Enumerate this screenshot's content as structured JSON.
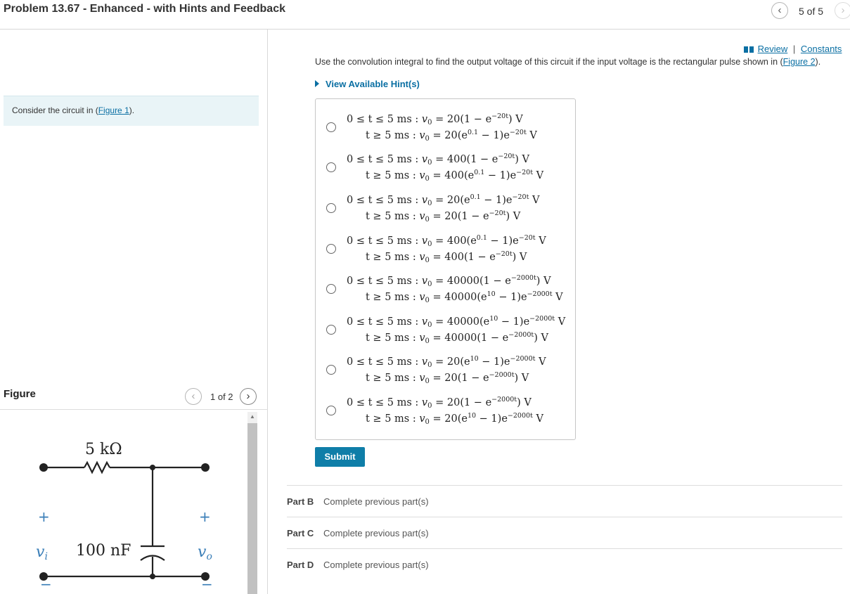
{
  "header": {
    "title": "Problem 13.67 - Enhanced - with Hints and Feedback",
    "prev_icon": "chevron-left-icon",
    "next_icon": "chevron-right-icon",
    "count": "5 of 5"
  },
  "left": {
    "consider_prefix": "Consider the circuit in (",
    "consider_link": "Figure 1",
    "consider_suffix": ").",
    "figure_label": "Figure",
    "figure_count": "1 of 2",
    "circuit": {
      "resistor": "5 kΩ",
      "capacitor": "100 nF",
      "plus": "+",
      "minus": "−",
      "vi": "v",
      "vi_sub": "i",
      "vo": "v",
      "vo_sub": "o"
    }
  },
  "right": {
    "review": "Review",
    "separator": "|",
    "constants": "Constants",
    "instruction_prefix": "Use the convolution integral to find the output voltage of this circuit if the input voltage is the rectangular pulse shown in (",
    "instruction_link": "Figure 2",
    "instruction_suffix": ").",
    "hints": "View Available Hint(s)",
    "submit": "Submit",
    "options": [
      {
        "l1": {
          "cond": "0 ≤ t ≤ 5 ms :",
          "a": "v",
          "s": "0",
          "b": " = 20(1 − e",
          "e1": "−20t",
          "c": ") V",
          "e2": "",
          "d": ""
        },
        "l2": {
          "cond": "t ≥ 5 ms :",
          "a": "v",
          "s": "0",
          "b": " = 20(e",
          "e1": "0.1",
          "c": " − 1)e",
          "e2": "−20t",
          "d": " V"
        }
      },
      {
        "l1": {
          "cond": "0 ≤ t ≤ 5 ms :",
          "a": "v",
          "s": "0",
          "b": " = 400(1 − e",
          "e1": "−20t",
          "c": ") V",
          "e2": "",
          "d": ""
        },
        "l2": {
          "cond": "t ≥ 5 ms :",
          "a": "v",
          "s": "0",
          "b": " = 400(e",
          "e1": "0.1",
          "c": " − 1)e",
          "e2": "−20t",
          "d": " V"
        }
      },
      {
        "l1": {
          "cond": "0 ≤ t ≤ 5 ms :",
          "a": "v",
          "s": "0",
          "b": " = 20(e",
          "e1": "0.1",
          "c": " − 1)e",
          "e2": "−20t",
          "d": " V"
        },
        "l2": {
          "cond": "t ≥ 5 ms :",
          "a": "v",
          "s": "0",
          "b": " = 20(1 − e",
          "e1": "−20t",
          "c": ") V",
          "e2": "",
          "d": ""
        }
      },
      {
        "l1": {
          "cond": "0 ≤ t ≤ 5 ms :",
          "a": "v",
          "s": "0",
          "b": " = 400(e",
          "e1": "0.1",
          "c": " − 1)e",
          "e2": "−20t",
          "d": " V"
        },
        "l2": {
          "cond": "t ≥ 5 ms :",
          "a": "v",
          "s": "0",
          "b": " = 400(1 − e",
          "e1": "−20t",
          "c": ") V",
          "e2": "",
          "d": ""
        }
      },
      {
        "l1": {
          "cond": "0 ≤ t ≤ 5 ms :",
          "a": "v",
          "s": "0",
          "b": " = 40000(1 − e",
          "e1": "−2000t",
          "c": ") V",
          "e2": "",
          "d": ""
        },
        "l2": {
          "cond": "t ≥ 5 ms :",
          "a": "v",
          "s": "0",
          "b": " = 40000(e",
          "e1": "10",
          "c": " − 1)e",
          "e2": "−2000t",
          "d": " V"
        }
      },
      {
        "l1": {
          "cond": "0 ≤ t ≤ 5 ms :",
          "a": "v",
          "s": "0",
          "b": " = 40000(e",
          "e1": "10",
          "c": " − 1)e",
          "e2": "−2000t",
          "d": " V"
        },
        "l2": {
          "cond": "t ≥ 5 ms :",
          "a": "v",
          "s": "0",
          "b": " = 40000(1 − e",
          "e1": "−2000t",
          "c": ") V",
          "e2": "",
          "d": ""
        }
      },
      {
        "l1": {
          "cond": "0 ≤ t ≤ 5 ms :",
          "a": "v",
          "s": "0",
          "b": " = 20(e",
          "e1": "10",
          "c": " − 1)e",
          "e2": "−2000t",
          "d": " V"
        },
        "l2": {
          "cond": "t ≥ 5 ms :",
          "a": "v",
          "s": "0",
          "b": " = 20(1 − e",
          "e1": "−2000t",
          "c": ") V",
          "e2": "",
          "d": ""
        }
      },
      {
        "l1": {
          "cond": "0 ≤ t ≤ 5 ms :",
          "a": "v",
          "s": "0",
          "b": " = 20(1 − e",
          "e1": "−2000t",
          "c": ") V",
          "e2": "",
          "d": ""
        },
        "l2": {
          "cond": "t ≥ 5 ms :",
          "a": "v",
          "s": "0",
          "b": " = 20(e",
          "e1": "10",
          "c": " − 1)e",
          "e2": "−2000t",
          "d": " V"
        }
      }
    ],
    "parts": [
      {
        "label": "Part B",
        "status": "Complete previous part(s)"
      },
      {
        "label": "Part C",
        "status": "Complete previous part(s)"
      },
      {
        "label": "Part D",
        "status": "Complete previous part(s)"
      }
    ]
  }
}
